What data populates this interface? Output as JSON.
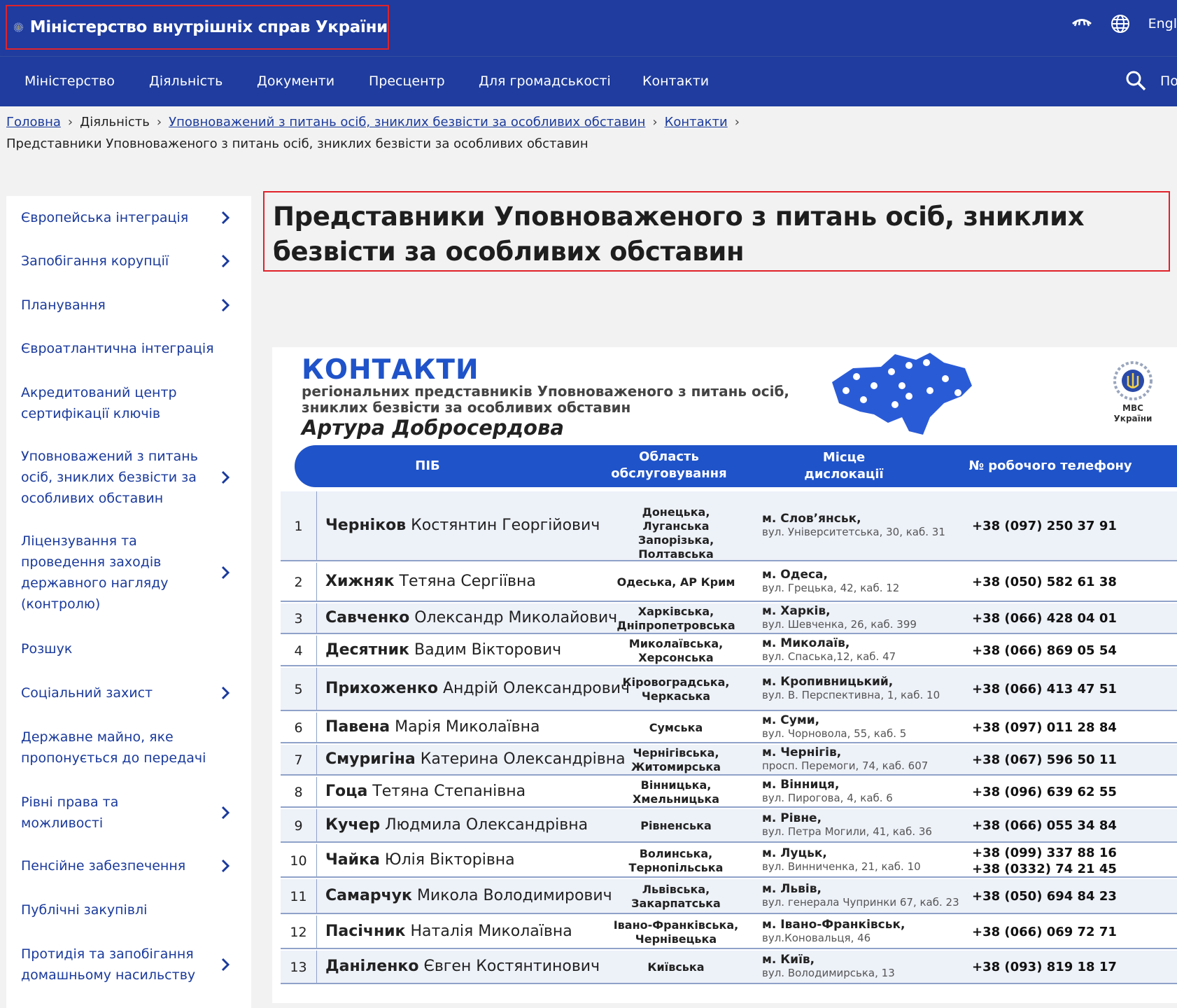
{
  "header": {
    "site_title": "Міністерство внутрішніх справ України",
    "language_label": "Engl",
    "colors": {
      "primary": "#1f3c9e",
      "accent_red": "#e0222a",
      "table_blue": "#1f53c9"
    },
    "icons": [
      "ministry-logo-icon",
      "eye-icon",
      "globe-icon"
    ]
  },
  "nav": {
    "items": [
      "Міністерство",
      "Діяльність",
      "Документи",
      "Пресцентр",
      "Для громадськості",
      "Контакти"
    ],
    "search_label": "По"
  },
  "breadcrumb": {
    "home": "Головна",
    "activity": "Діяльність",
    "commissioner": "Уповноважений з питань осіб, зниклих безвісти за особливих обставин",
    "contacts": "Контакти",
    "current": "Представники Уповноваженого з питань осіб, зниклих безвісти за особливих обставин"
  },
  "sidebar": {
    "items": [
      "Європейська інтеграція",
      "Запобігання корупції",
      "Планування",
      "Євроатлантична інтеграція",
      "Акредитований центр сертифікації ключів",
      "Уповноважений з питань осіб, зниклих безвісти за особливих обставин",
      "Ліцензування та проведення заходів державного нагляду (контролю)",
      "Розшук",
      "Соціальний захист",
      "Державне майно, яке пропонується до передачі",
      "Рівні права та можливості",
      "Пенсійне забезпечення",
      "Публічні закупівлі",
      "Протидія та запобігання домашньому насильству"
    ]
  },
  "page": {
    "title": "Представники Уповноваженого з питань осіб, зниклих безвісти за особливих обставин"
  },
  "infographic": {
    "title": "КОНТАКТИ",
    "subtitle_line1": "регіональних представників Уповноваженого з питань осіб,",
    "subtitle_line2": "зниклих безвісти за особливих обставин",
    "name": "Артура Добросердова",
    "logo_line1": "МВС",
    "logo_line2": "України",
    "headers": {
      "pib": "ПІБ",
      "region_1": "Область",
      "region_2": "обслуговування",
      "place_1": "Місце",
      "place_2": "дислокації",
      "phone": "№ робочого телефону"
    },
    "rows": [
      {
        "n": "1",
        "surname": "Черніков",
        "given": "Костянтин Георгійович",
        "region": "Донецька, Луганська Запорізька, Полтавська",
        "city": "м. Слов’янськ,",
        "address": "вул. Університетська, 30, каб. 31",
        "phone": "+38 (097) 250 37 91",
        "phone2": ""
      },
      {
        "n": "2",
        "surname": "Хижняк",
        "given": "Тетяна Сергіївна",
        "region": "Одеська, АР Крим",
        "city": "м. Одеса,",
        "address": "вул. Грецька, 42, каб. 12",
        "phone": "+38 (050) 582 61 38",
        "phone2": ""
      },
      {
        "n": "3",
        "surname": "Савченко",
        "given": "Олександр Миколайович",
        "region": "Харківська, Дніпропетровська",
        "city": "м. Харків,",
        "address": "вул. Шевченка, 26, каб. 399",
        "phone": "+38 (066) 428 04 01",
        "phone2": ""
      },
      {
        "n": "4",
        "surname": "Десятник",
        "given": "Вадим Вікторович",
        "region": "Миколаївська, Херсонська",
        "city": "м. Миколаїв,",
        "address": "вул. Спаська,12, каб. 47",
        "phone": "+38 (066) 869 05 54",
        "phone2": ""
      },
      {
        "n": "5",
        "surname": "Прихоженко",
        "given": "Андрій Олександрович",
        "region": "Кіровоградська, Черкаська",
        "city": "м. Кропивницький,",
        "address": "вул. В. Перспективна, 1, каб. 10",
        "phone": "+38 (066) 413 47 51",
        "phone2": ""
      },
      {
        "n": "6",
        "surname": "Павена",
        "given": "Марія Миколаївна",
        "region": "Сумська",
        "city": "м. Суми,",
        "address": "вул. Чорновола, 55, каб. 5",
        "phone": "+38 (097) 011 28 84",
        "phone2": ""
      },
      {
        "n": "7",
        "surname": "Смуригіна",
        "given": "Катерина Олександрівна",
        "region": "Чернігівська, Житомирська",
        "city": "м. Чернігів,",
        "address": "просп. Перемоги, 74, каб. 607",
        "phone": "+38 (067) 596 50 11",
        "phone2": ""
      },
      {
        "n": "8",
        "surname": "Гоца",
        "given": "Тетяна Степанівна",
        "region": "Вінницька, Хмельницька",
        "city": "м. Вінниця,",
        "address": "вул. Пирогова, 4, каб. 6",
        "phone": "+38 (096) 639 62 55",
        "phone2": ""
      },
      {
        "n": "9",
        "surname": "Кучер",
        "given": "Людмила Олександрівна",
        "region": "Рівненська",
        "city": "м. Рівне,",
        "address": "вул. Петра Могили, 41, каб. 36",
        "phone": "+38 (066) 055 34 84",
        "phone2": ""
      },
      {
        "n": "10",
        "surname": "Чайка",
        "given": "Юлія Вікторівна",
        "region": "Волинська, Тернопільська",
        "city": "м. Луцьк,",
        "address": "вул. Винниченка, 21, каб. 10",
        "phone": "+38 (099) 337 88 16",
        "phone2": "+38 (0332) 74 21 45"
      },
      {
        "n": "11",
        "surname": "Самарчук",
        "given": "Микола Володимирович",
        "region": "Львівська, Закарпатська",
        "city": "м. Львів,",
        "address": "вул. генерала Чупринки 67, каб. 23",
        "phone": "+38 (050) 694 84 23",
        "phone2": ""
      },
      {
        "n": "12",
        "surname": "Пасічник",
        "given": "Наталія Миколаївна",
        "region": "Івано-Франківська, Чернівецька",
        "city": "м. Івано-Франківськ,",
        "address": "вул.Коновальця, 46",
        "phone": "+38 (066) 069 72 71",
        "phone2": ""
      },
      {
        "n": "13",
        "surname": "Даніленко",
        "given": "Євген Костянтинович",
        "region": "Київська",
        "city": "м. Київ,",
        "address": "вул. Володимирська, 13",
        "phone": "+38 (093) 819 18 17",
        "phone2": ""
      }
    ]
  }
}
